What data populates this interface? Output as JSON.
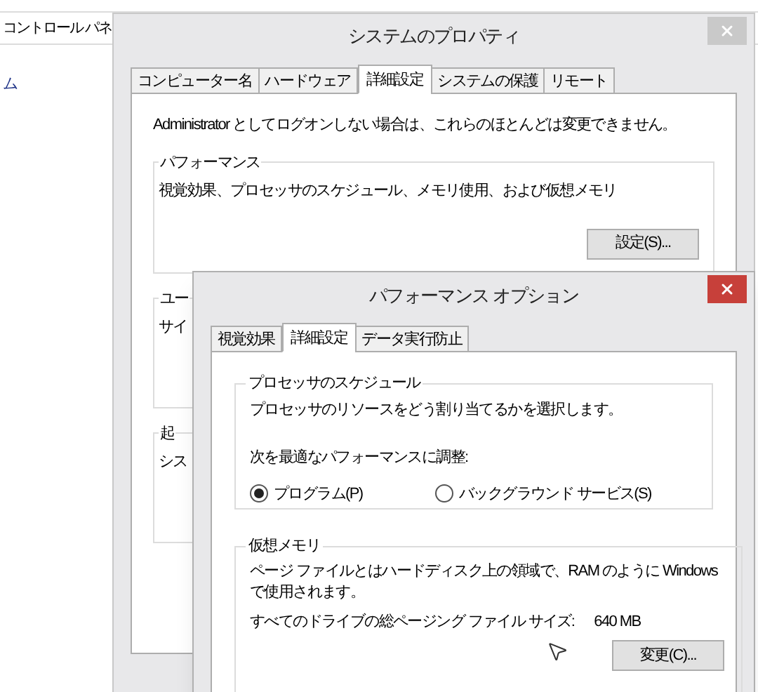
{
  "background_window": {
    "title": "コントロール パネ",
    "items": [
      "ム"
    ]
  },
  "system_properties": {
    "title": "システムのプロパティ",
    "active": false,
    "tabs": [
      {
        "label": "コンピューター名",
        "selected": false
      },
      {
        "label": "ハードウェア",
        "selected": false
      },
      {
        "label": "詳細設定",
        "selected": true
      },
      {
        "label": "システムの保護",
        "selected": false
      },
      {
        "label": "リモート",
        "selected": false
      }
    ],
    "note": "Administrator としてログオンしない場合は、これらのほとんどは変更できません。",
    "groups": [
      {
        "title": "パフォーマンス",
        "text": "視覚効果、プロセッサのスケジュール、メモリ使用、および仮想メモリ",
        "button": "設定(S)..."
      },
      {
        "title": "ユー",
        "text": "サイ"
      },
      {
        "title": "起",
        "text": "シス"
      }
    ]
  },
  "performance_options": {
    "title": "パフォーマンス オプション",
    "active": true,
    "tabs": [
      {
        "label": "視覚効果",
        "selected": false
      },
      {
        "label": "詳細設定",
        "selected": true
      },
      {
        "label": "データ実行防止",
        "selected": false
      }
    ],
    "processor_group": {
      "title": "プロセッサのスケジュール",
      "description": "プロセッサのリソースをどう割り当てるかを選択します。",
      "prompt": "次を最適なパフォーマンスに調整:",
      "options": [
        {
          "label": "プログラム(P)",
          "selected": true
        },
        {
          "label": "バックグラウンド サービス(S)",
          "selected": false
        }
      ]
    },
    "virtual_memory": {
      "title": "仮想メモリ",
      "description": "ページ ファイルとはハードディスク上の領域で、RAM のように Windows で使用されます。",
      "total_label": "すべてのドライブの総ページング ファイル サイズ:",
      "total_value": "640 MB",
      "button": "変更(C)..."
    }
  }
}
